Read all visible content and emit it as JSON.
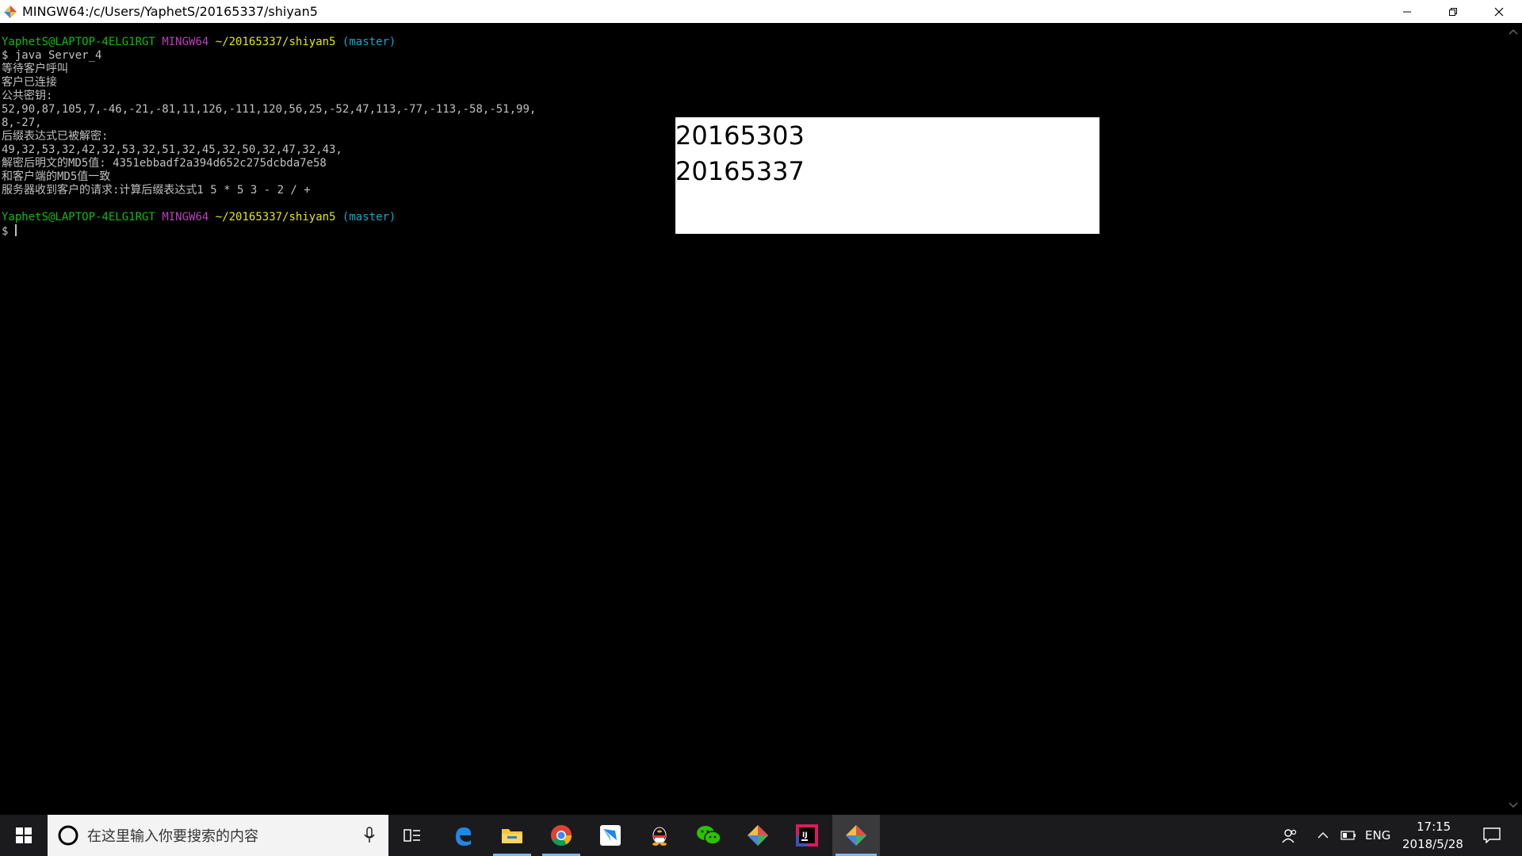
{
  "window": {
    "title": "MINGW64:/c/Users/YaphetS/20165337/shiyan5"
  },
  "prompt": {
    "user_host": "YaphetS@LAPTOP-4ELG1RGT",
    "system": "MINGW64",
    "path": "~/20165337/shiyan5",
    "branch": "(master)"
  },
  "terminal": {
    "command": "$ java Server_4",
    "output": [
      "等待客户呼叫",
      "客户已连接",
      "公共密钥:",
      "52,90,87,105,7,-46,-21,-81,11,126,-111,120,56,25,-52,47,113,-77,-113,-58,-51,99,",
      "8,-27,",
      "后缀表达式已被解密:",
      "49,32,53,32,42,32,53,32,51,32,45,32,50,32,47,32,43,",
      "解密后明文的MD5值: 4351ebbadf2a394d652c275dcbda7e58",
      "和客户端的MD5值一致",
      "服务器收到客户的请求:计算后缀表达式1 5 * 5 3 - 2 / +"
    ],
    "final_prompt": "$ "
  },
  "overlay": {
    "line1": "20165303",
    "line2": "20165337"
  },
  "taskbar": {
    "search_placeholder": "在这里输入你要搜索的内容",
    "lang": "ENG",
    "time": "17:15",
    "date": "2018/5/28",
    "apps": [
      "start-icon",
      "task-view-icon",
      "edge-icon",
      "file-explorer-icon",
      "chrome-icon",
      "feishu-icon",
      "qq-icon",
      "wechat-icon",
      "git-icon",
      "intellij-icon",
      "git-bash-icon"
    ]
  },
  "colors": {
    "prompt_user": "#0dbc0d",
    "prompt_system": "#bc3fbc",
    "prompt_path": "#e5e510",
    "prompt_branch": "#11a8cd",
    "taskbar_bg": "#1b1b1d"
  }
}
